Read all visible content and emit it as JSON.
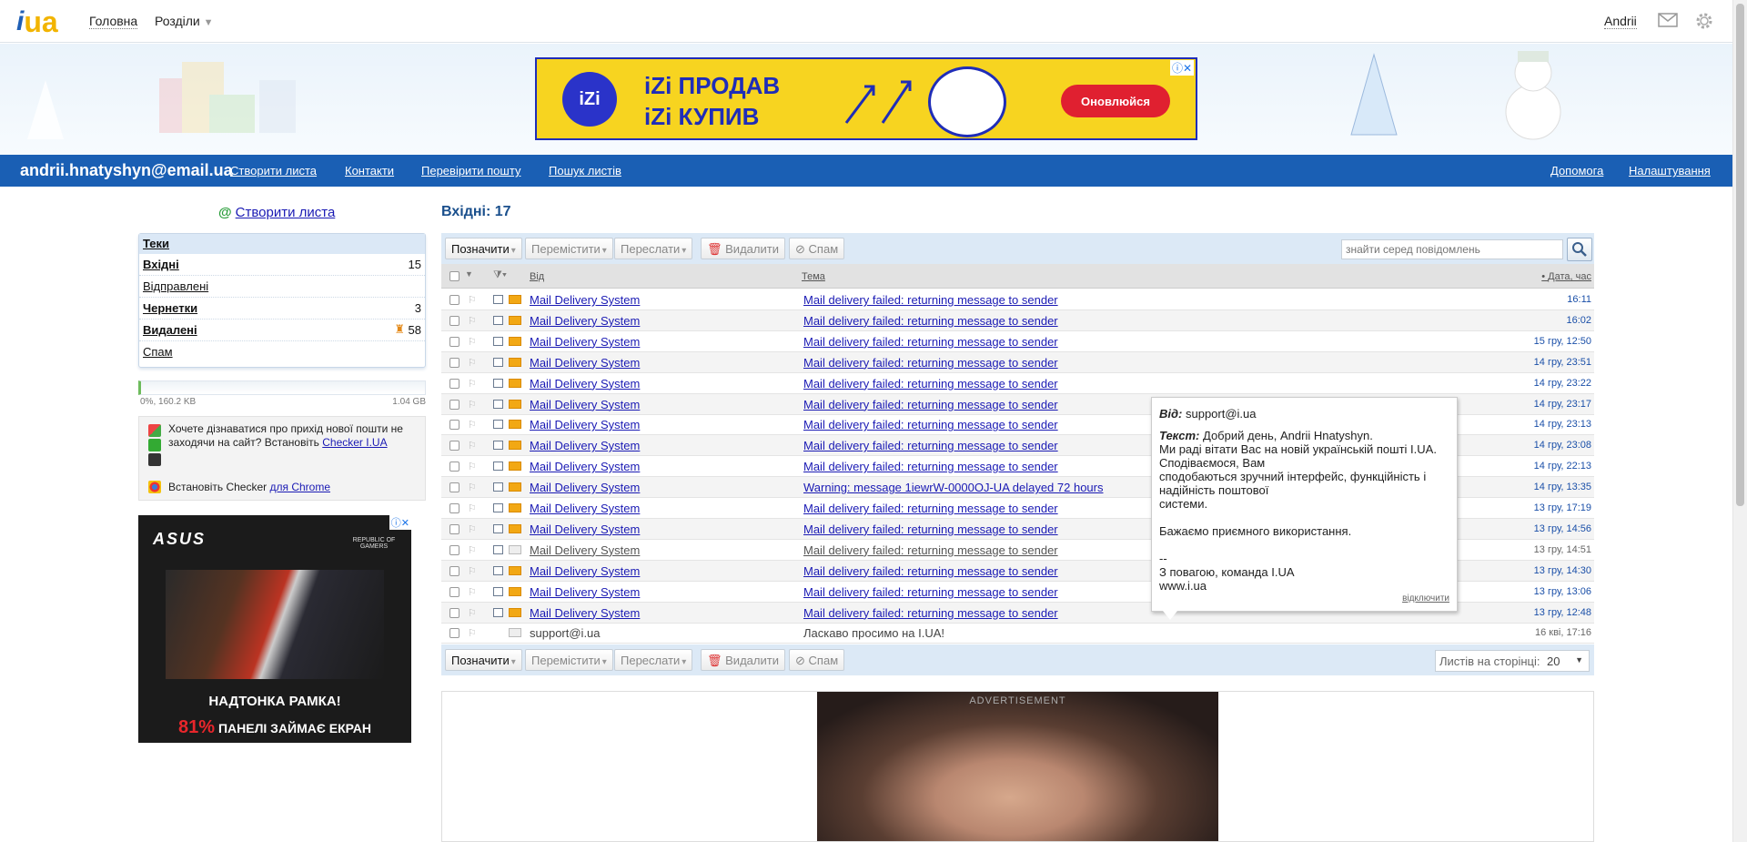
{
  "topbar": {
    "home": "Головна",
    "sections": "Розділи",
    "user": "Andrii"
  },
  "ads": {
    "top": {
      "line1": "iZi ПРОДАВ",
      "line2": "iZi КУПИВ",
      "logo": "iZi",
      "button": "Оновлюйся"
    },
    "left": {
      "brand": "ASUS",
      "sub": "REPUBLIC OF GAMERS",
      "line1": "НАДТОНКА РАМКА!",
      "pct": "81%",
      "line2": " ПАНЕЛІ ЗАЙМАЄ ЕКРАН"
    },
    "bottom": {
      "label": "ADVERTISEMENT"
    }
  },
  "bluebar": {
    "email": "andrii.hnatyshyn@email.ua",
    "links": [
      "Створити листа",
      "Контакти",
      "Перевірити пошту",
      "Пошук листів"
    ],
    "right": [
      "Допомога",
      "Налаштування"
    ]
  },
  "sidebar": {
    "create": "Створити листа",
    "folders_title": "Теки",
    "folders": [
      {
        "name": "Вхідні",
        "count": "15"
      },
      {
        "name": "Відправлені",
        "count": ""
      },
      {
        "name": "Чернетки",
        "count": "3"
      },
      {
        "name": "Видалені",
        "count": "58"
      },
      {
        "name": "Спам",
        "count": ""
      }
    ],
    "quota_used": "0%, 160.2 KB",
    "quota_total": "1.04 GB",
    "quota_fraction": 0.0,
    "checker_text": "Хочете дізнаватися про прихід нової пошти не заходячи на сайт? Встановіть",
    "checker_link": "Checker I.UA",
    "chrome_text": "Встановіть Checker ",
    "chrome_link": "для Chrome"
  },
  "main": {
    "title": "Вхідні: 17",
    "toolbar": {
      "mark": "Позначити",
      "move": "Перемістити",
      "forward": "Переслати",
      "delete": "Видалити",
      "spam": "Спам"
    },
    "search_placeholder": "знайти серед повідомлень",
    "columns": {
      "from": "Від",
      "subject": "Тема",
      "date": "Дата, час"
    },
    "messages": [
      {
        "from": "Mail Delivery System",
        "subject": "Mail delivery failed: returning message to sender",
        "date": "16:11"
      },
      {
        "from": "Mail Delivery System",
        "subject": "Mail delivery failed: returning message to sender",
        "date": "16:02"
      },
      {
        "from": "Mail Delivery System",
        "subject": "Mail delivery failed: returning message to sender",
        "date": "15 гру, 12:50"
      },
      {
        "from": "Mail Delivery System",
        "subject": "Mail delivery failed: returning message to sender",
        "date": "14 гру, 23:51"
      },
      {
        "from": "Mail Delivery System",
        "subject": "Mail delivery failed: returning message to sender",
        "date": "14 гру, 23:22"
      },
      {
        "from": "Mail Delivery System",
        "subject": "Mail delivery failed: returning message to sender",
        "date": "14 гру, 23:17"
      },
      {
        "from": "Mail Delivery System",
        "subject": "Mail delivery failed: returning message to sender",
        "date": "14 гру, 23:13"
      },
      {
        "from": "Mail Delivery System",
        "subject": "Mail delivery failed: returning message to sender",
        "date": "14 гру, 23:08"
      },
      {
        "from": "Mail Delivery System",
        "subject": "Mail delivery failed: returning message to sender",
        "date": "14 гру, 22:13"
      },
      {
        "from": "Mail Delivery System",
        "subject": "Warning: message 1iewrW-0000OJ-UA delayed 72 hours",
        "date": "14 гру, 13:35"
      },
      {
        "from": "Mail Delivery System",
        "subject": "Mail delivery failed: returning message to sender",
        "date": "13 гру, 17:19"
      },
      {
        "from": "Mail Delivery System",
        "subject": "Mail delivery failed: returning message to sender",
        "date": "13 гру, 14:56"
      },
      {
        "from": "Mail Delivery System",
        "subject": "Mail delivery failed: returning message to sender",
        "date": "13 гру, 14:51"
      },
      {
        "from": "Mail Delivery System",
        "subject": "Mail delivery failed: returning message to sender",
        "date": "13 гру, 14:30"
      },
      {
        "from": "Mail Delivery System",
        "subject": "Mail delivery failed: returning message to sender",
        "date": "13 гру, 13:06"
      },
      {
        "from": "Mail Delivery System",
        "subject": "Mail delivery failed: returning message to sender",
        "date": "13 гру, 12:48"
      },
      {
        "from": "support@i.ua",
        "subject": "Ласкаво просимо на I.UA!",
        "date": "16 кві, 17:16"
      }
    ],
    "tooltip": {
      "from_label": "Від:",
      "from_value": " support@i.ua",
      "text_label": "Текст:",
      "text_value": " Добрий день, Andrii Hnatyshyn.\nМи раді вітати Вас на новій українській пошті I.UA.\nСподіваємося, Вам\nсподобаються зручний інтерфейс, функційність і надійність поштової\nсистеми.\n\nБажаємо приємного використання.\n\n--\nЗ повагою, команда I.UA\nwww.i.ua",
      "disable": "відключити"
    },
    "per_page_label": "Листів на сторінці:",
    "per_page_value": "20"
  }
}
